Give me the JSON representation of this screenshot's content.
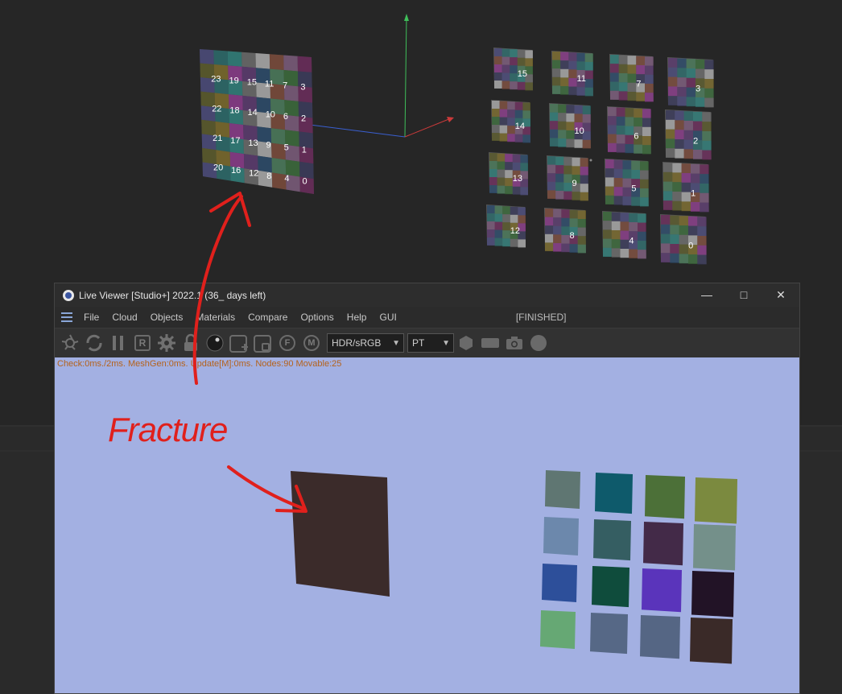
{
  "window": {
    "title": "Live Viewer [Studio+] 2022.1 (36_ days left)",
    "minimize_icon": "minimize-icon",
    "maximize_icon": "maximize-icon",
    "close_icon": "close-icon"
  },
  "menu": {
    "items": [
      "File",
      "Cloud",
      "Objects",
      "Materials",
      "Compare",
      "Options",
      "Help",
      "GUI"
    ],
    "status": "[FINISHED]"
  },
  "toolbar": {
    "icons": [
      "shutter-icon",
      "refresh-icon",
      "pause-icon",
      "r-icon",
      "gear-icon",
      "lock-icon",
      "sphere-icon",
      "add-box-icon",
      "region-box-icon",
      "f-icon",
      "m-icon"
    ],
    "color_space": "HDR/sRGB",
    "render_mode": "PT",
    "right_icons": [
      "hexagon-icon",
      "rectangle-icon",
      "camera-icon",
      "circle-icon"
    ]
  },
  "viewport": {
    "stats": "Check:0ms./2ms. MeshGen:0ms. Update[M]:0ms. Nodes:90 Movable:25"
  },
  "left_object_labels": [
    "23",
    "19",
    "15",
    "11",
    "7",
    "3",
    "22",
    "18",
    "14",
    "10",
    "6",
    "2",
    "21",
    "17",
    "13",
    "9",
    "5",
    "1",
    "20",
    "16",
    "12",
    "8",
    "4",
    "0"
  ],
  "right_grid_labels": [
    "15",
    "11",
    "7",
    "3",
    "14",
    "10",
    "6",
    "2",
    "13",
    "9",
    "5",
    "1",
    "12",
    "8",
    "4",
    "0"
  ],
  "annotation": {
    "text": "Fracture",
    "color": "#e0201c"
  },
  "render_swatches": [
    "#5f7672",
    "#0e5a6b",
    "#4c7038",
    "#7b8a3f",
    "#6c88ac",
    "#355e62",
    "#432a48",
    "#74908a",
    "#2d4f9a",
    "#0f4c3c",
    "#5a34bb",
    "#221326",
    "#66a874",
    "#566886",
    "#556684",
    "#3a2a28"
  ],
  "fractured_object_color": "#3b2b2a"
}
